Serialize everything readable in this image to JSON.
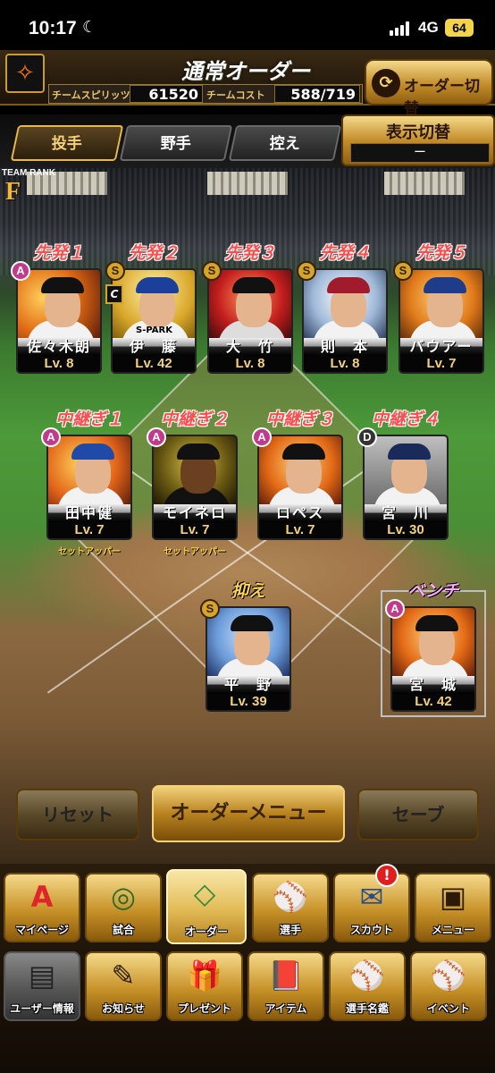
{
  "status_bar": {
    "time": "10:17",
    "network": "4G",
    "battery": "64"
  },
  "header": {
    "title": "通常オーダー",
    "team_spirits_label": "チームスピリッツ",
    "team_spirits_value": "61520",
    "team_cost_label": "チームコスト",
    "team_cost_value": "588/719",
    "order_switch_label": "オーダー切替"
  },
  "tabs": [
    {
      "label": "投手",
      "active": true
    },
    {
      "label": "野手",
      "active": false
    },
    {
      "label": "控え",
      "active": false
    }
  ],
  "display_switch": {
    "label": "表示切替",
    "value": "ー"
  },
  "team_rank": {
    "label": "TEAM RANK",
    "rank": "F"
  },
  "starters": [
    {
      "position": "先発１",
      "name": "佐々木朗",
      "level": "Lv.  8",
      "grade": "A"
    },
    {
      "position": "先発２",
      "name": "伊　藤",
      "level": "Lv. 42",
      "grade": "S",
      "captain": "C",
      "card_text": "S-PARK"
    },
    {
      "position": "先発３",
      "name": "大　竹",
      "level": "Lv.  8",
      "grade": "S"
    },
    {
      "position": "先発４",
      "name": "則　本",
      "level": "Lv.  8",
      "grade": "S"
    },
    {
      "position": "先発５",
      "name": "バウアー",
      "level": "Lv.  7",
      "grade": "S"
    }
  ],
  "relievers": [
    {
      "position": "中継ぎ１",
      "name": "田中健",
      "level": "Lv.  7",
      "grade": "A",
      "role": "セットアッパー"
    },
    {
      "position": "中継ぎ２",
      "name": "モイネロ",
      "level": "Lv.  7",
      "grade": "A",
      "role": "セットアッパー"
    },
    {
      "position": "中継ぎ３",
      "name": "ロペス",
      "level": "Lv.  7",
      "grade": "A"
    },
    {
      "position": "中継ぎ４",
      "name": "宮　川",
      "level": "Lv. 30",
      "grade": "D"
    }
  ],
  "closer": {
    "position": "抑え",
    "name": "平　野",
    "level": "Lv. 39",
    "grade": "S"
  },
  "bench": {
    "position": "ベンチ",
    "name": "宮　城",
    "level": "Lv. 42",
    "grade": "A"
  },
  "actions": {
    "reset": "リセット",
    "order_menu": "オーダーメニュー",
    "save": "セーブ"
  },
  "nav_top": [
    {
      "label": "マイページ",
      "icon": "A"
    },
    {
      "label": "試合",
      "icon": "◎"
    },
    {
      "label": "オーダー",
      "icon": "◇"
    },
    {
      "label": "選手",
      "icon": "⚾"
    },
    {
      "label": "スカウト",
      "icon": "✉"
    },
    {
      "label": "メニュー",
      "icon": "▣"
    }
  ],
  "nav_bottom": [
    {
      "label": "ユーザー情報",
      "icon": "▤"
    },
    {
      "label": "お知らせ",
      "icon": "✎"
    },
    {
      "label": "プレゼント",
      "icon": "🎁"
    },
    {
      "label": "アイテム",
      "icon": "📕"
    },
    {
      "label": "選手名鑑",
      "icon": "⚾"
    },
    {
      "label": "イベント",
      "icon": "⚾"
    }
  ],
  "scout_badge": "!",
  "colors": {
    "gold": "#c48d2b",
    "starter_red": "#ff4d4d",
    "level_gold": "#f4d27a"
  }
}
